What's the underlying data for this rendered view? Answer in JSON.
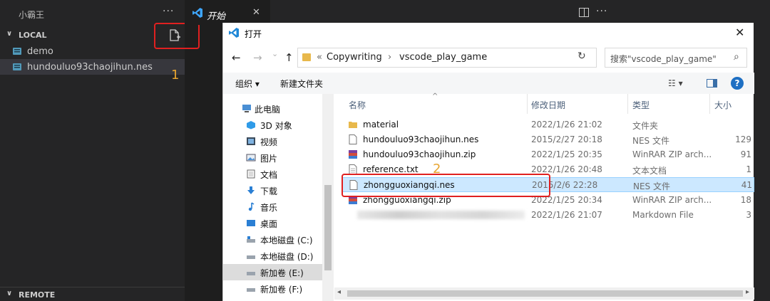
{
  "sidebar": {
    "title": "小霸王",
    "more": "···",
    "local_section": "LOCAL",
    "remote_section": "REMOTE",
    "items": [
      {
        "label": "demo"
      },
      {
        "label": "hundouluo93chaojihun.nes"
      }
    ]
  },
  "annotations": {
    "one": "1",
    "two": "2"
  },
  "editor": {
    "tab_label": "开始",
    "tab_close": "✕",
    "more": "···"
  },
  "dialog": {
    "title": "打开",
    "close": "✕",
    "nav": {
      "back": "←",
      "forward": "→",
      "down": "⌄",
      "up": "↑",
      "refresh": "↻"
    },
    "breadcrumb": [
      "«",
      "Copywriting",
      "›",
      "vscode_play_game",
      "›"
    ],
    "search_placeholder": "搜索\"vscode_play_game\"",
    "search_icon": "⌕",
    "toolbar": {
      "organize": "组织 ▾",
      "new_folder": "新建文件夹",
      "view": "☷ ▾",
      "help": "?"
    },
    "nav_pane": [
      {
        "label": "此电脑",
        "icon": "computer-icon"
      },
      {
        "label": "3D 对象",
        "icon": "3d-objects-icon"
      },
      {
        "label": "视频",
        "icon": "video-icon"
      },
      {
        "label": "图片",
        "icon": "pictures-icon"
      },
      {
        "label": "文档",
        "icon": "documents-icon"
      },
      {
        "label": "下载",
        "icon": "download-icon"
      },
      {
        "label": "音乐",
        "icon": "music-icon"
      },
      {
        "label": "桌面",
        "icon": "desktop-icon"
      },
      {
        "label": "本地磁盘 (C:)",
        "icon": "drive-icon"
      },
      {
        "label": "本地磁盘 (D:)",
        "icon": "drive-icon"
      },
      {
        "label": "新加卷 (E:)",
        "icon": "drive-icon"
      },
      {
        "label": "新加卷 (F:)",
        "icon": "drive-icon"
      }
    ],
    "columns": {
      "name": "名称",
      "date": "修改日期",
      "type": "类型",
      "size": "大小",
      "sort": "^"
    },
    "files": [
      {
        "name": "material",
        "date": "2022/1/26 21:02",
        "type": "文件夹",
        "size": "",
        "icon": "folder-icon"
      },
      {
        "name": "hundouluo93chaojihun.nes",
        "date": "2015/2/27 20:18",
        "type": "NES 文件",
        "size": "129",
        "icon": "file-icon"
      },
      {
        "name": "hundouluo93chaojihun.zip",
        "date": "2022/1/25 20:35",
        "type": "WinRAR ZIP arch...",
        "size": "91",
        "icon": "winrar-icon"
      },
      {
        "name": "reference.txt",
        "date": "2022/1/26 20:48",
        "type": "文本文档",
        "size": "1",
        "icon": "text-file-icon"
      },
      {
        "name": "zhongguoxiangqi.nes",
        "date": "2015/2/6 22:28",
        "type": "NES 文件",
        "size": "41",
        "icon": "file-icon"
      },
      {
        "name": "zhongguoxiangqi.zip",
        "date": "2022/1/25 20:34",
        "type": "WinRAR ZIP arch...",
        "size": "18",
        "icon": "winrar-icon"
      },
      {
        "name": "",
        "date": "2022/1/26 21:07",
        "type": "Markdown File",
        "size": "3",
        "icon": "blurred-icon"
      }
    ],
    "hscroll": {
      "left": "◂",
      "right": "▸"
    }
  }
}
